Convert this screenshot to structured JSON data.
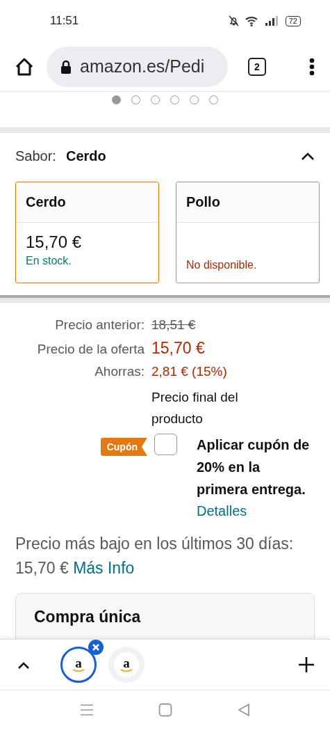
{
  "status_bar": {
    "time": "11:51",
    "battery": "72"
  },
  "browser": {
    "url": "amazon.es/Pedi",
    "tab_count": "2"
  },
  "carousel": {
    "dots": [
      {
        "selected": true
      },
      {
        "selected": false
      },
      {
        "selected": false
      },
      {
        "selected": false
      },
      {
        "selected": false
      },
      {
        "selected": false
      }
    ]
  },
  "variation": {
    "label": "Sabor:",
    "value": "Cerdo",
    "expanded": true,
    "options": [
      {
        "name": "Cerdo",
        "price": "15,70 €",
        "availability": "En stock.",
        "in_stock": true,
        "selected": true
      },
      {
        "name": "Pollo",
        "availability": "No disponible.",
        "in_stock": false,
        "selected": false
      }
    ]
  },
  "pricing": {
    "rows": [
      {
        "label": "Precio anterior:",
        "value": "18,51 €",
        "kind": "struck"
      },
      {
        "label": "Precio de la oferta",
        "value": "15,70 €",
        "kind": "deal"
      },
      {
        "label": "Ahorras:",
        "value": "2,81 € (15%)",
        "kind": "savings"
      }
    ],
    "note": "Precio final del producto",
    "coupon": {
      "badge": "Cupón",
      "checked": false,
      "text": "Aplicar cupón de 20% en la primera entrega.",
      "link": "Detalles"
    }
  },
  "lowest_price": {
    "text": "Precio más bajo en los últimos 30 días: 15,70 €",
    "link": "Más Info"
  },
  "purchase_card": {
    "title": "Compra única"
  },
  "tab_strip": {
    "tabs": [
      {
        "logo": "a",
        "selected": true
      },
      {
        "logo": "a",
        "selected": false
      }
    ]
  }
}
